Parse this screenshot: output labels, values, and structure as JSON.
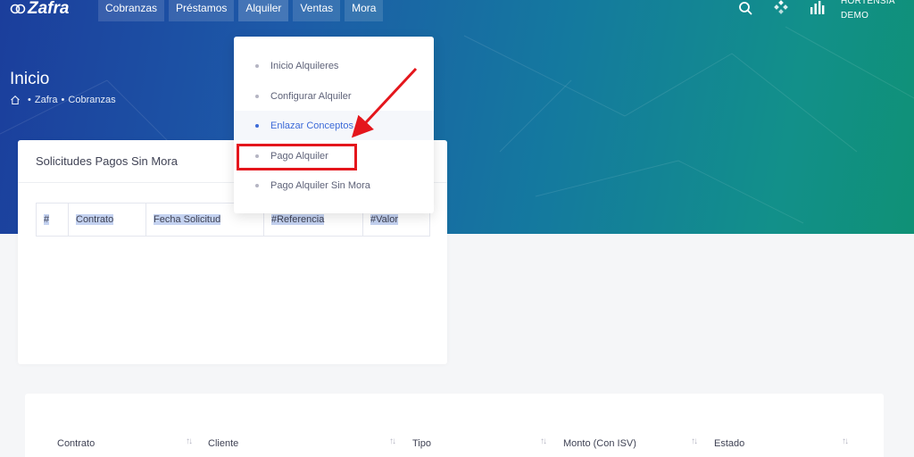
{
  "app": {
    "logo_text": "Zafra"
  },
  "nav": {
    "items": [
      "Cobranzas",
      "Préstamos",
      "Alquiler",
      "Ventas",
      "Mora"
    ]
  },
  "topbar": {
    "icons": [
      "search-icon",
      "apps-icon",
      "chart-icon"
    ],
    "user_line1": "HORTENSIA",
    "user_line2": "DEMO"
  },
  "page": {
    "title": "Inicio",
    "breadcrumb": [
      "Zafra",
      "Cobranzas"
    ]
  },
  "dropdown": {
    "items": [
      {
        "label": "Inicio Alquileres"
      },
      {
        "label": "Configurar Alquiler"
      },
      {
        "label": "Enlazar Conceptos"
      },
      {
        "label": "Pago Alquiler"
      },
      {
        "label": "Pago Alquiler Sin Mora"
      }
    ]
  },
  "solicitudes": {
    "title": "Solicitudes Pagos Sin Mora",
    "columns": [
      "#",
      "Contrato",
      "Fecha Solicitud",
      "#Referencia",
      "#Valor"
    ]
  },
  "contracts_table": {
    "columns": [
      "Contrato",
      "Cliente",
      "Tipo",
      "Monto (Con ISV)",
      "Estado"
    ]
  },
  "colors": {
    "highlight": "#e4161c",
    "accent": "#3c6ad8",
    "hero_start": "#1b3e9c",
    "hero_end": "#0f9176"
  }
}
